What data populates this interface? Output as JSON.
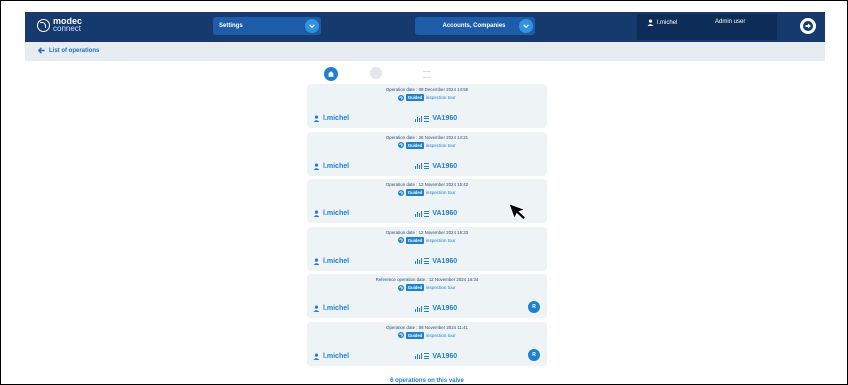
{
  "header": {
    "logo": {
      "line1": "modec",
      "line2": "connect"
    },
    "settings_label": "Settings",
    "accounts_label": "Accounts, Companies",
    "user_name": "l.michel",
    "user_role": "Admin user"
  },
  "breadcrumb": {
    "back_label": "List of operations"
  },
  "operations": [
    {
      "date": "Operation date : 09 December 2024 14:59",
      "type_badge": "Guided",
      "type_label": "inspection tour",
      "user": "l.michel",
      "valve": "VA1960",
      "reference": false
    },
    {
      "date": "Operation date : 26 November 2024 14:21",
      "type_badge": "Guided",
      "type_label": "inspection tour",
      "user": "l.michel",
      "valve": "VA1960",
      "reference": false
    },
    {
      "date": "Operation date : 13 November 2024 15:42",
      "type_badge": "Guided",
      "type_label": "inspection tour",
      "user": "l.michel",
      "valve": "VA1960",
      "reference": false
    },
    {
      "date": "Operation date : 12 November 2024 16:33",
      "type_badge": "Guided",
      "type_label": "inspection tour",
      "user": "l.michel",
      "valve": "VA1960",
      "reference": false
    },
    {
      "date": "Reference operation date : 12 November 2024 16:34",
      "type_badge": "Guided",
      "type_label": "inspection tour",
      "user": "l.michel",
      "valve": "VA1960",
      "reference": true,
      "ref_badge": "R"
    },
    {
      "date": "Operation date : 08 November 2024 11:41",
      "type_badge": "Guided",
      "type_label": "inspection tour",
      "user": "l.michel",
      "valve": "VA1960",
      "reference": true,
      "ref_badge": "R"
    }
  ],
  "footer": {
    "count_label": "6 operations on this valve"
  },
  "colors": {
    "header_bg": "#163a6e",
    "accent": "#1f7fd0",
    "card_bg": "#eef3f5"
  },
  "icons": [
    "logo-icon",
    "chevron-down-icon",
    "user-icon",
    "logout-icon",
    "arrow-left-icon",
    "timeline-view-icon",
    "list-view-icon",
    "refresh-icon",
    "valve-icon",
    "menu-icon",
    "mouse-cursor-icon"
  ]
}
